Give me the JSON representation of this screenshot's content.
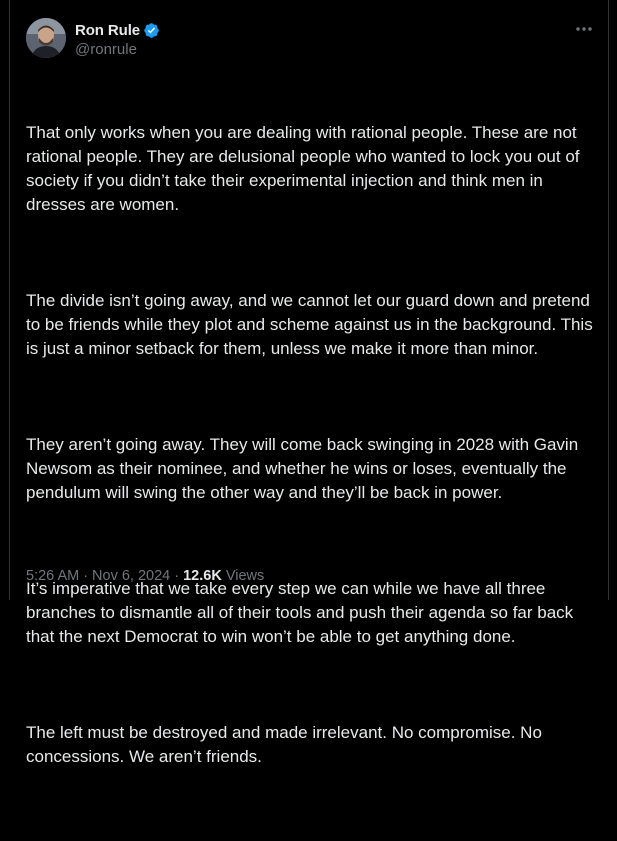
{
  "author": {
    "display_name": "Ron Rule",
    "handle": "@ronrule",
    "verified_icon": "verified-badge-icon",
    "verified_color": "#1d9bf0"
  },
  "more_icon": "more-horizontal-icon",
  "tweet": {
    "paragraphs": [
      "That only works when you are dealing with rational people. These are not rational people. They are delusional people who wanted to lock you out of society if you didn’t take their experimental injection and think men in dresses are women.",
      "The divide isn’t going away, and we cannot let our guard down and pretend to be friends while they plot and scheme against us in the background. This is just a minor setback for them, unless we make it more than minor.",
      "They aren’t going away. They will come back swinging in 2028 with Gavin Newsom as their nominee, and whether he wins or loses, eventually the pendulum will swing the other way and they’ll be back in power.",
      "It’s imperative that we take every step we can while we have all three branches to dismantle all of their tools and push their agenda so far back that the next Democrat to win won’t be able to get anything done.",
      "The left must be destroyed and made irrelevant. No compromise. No concessions. We aren’t friends."
    ]
  },
  "meta": {
    "time": "5:26 AM",
    "separator": "·",
    "date": "Nov 6, 2024",
    "views_count": "12.6K",
    "views_label": "Views"
  },
  "colors": {
    "background": "#000000",
    "text": "#e7e9ea",
    "secondary": "#71767b",
    "border": "#2f3336"
  }
}
